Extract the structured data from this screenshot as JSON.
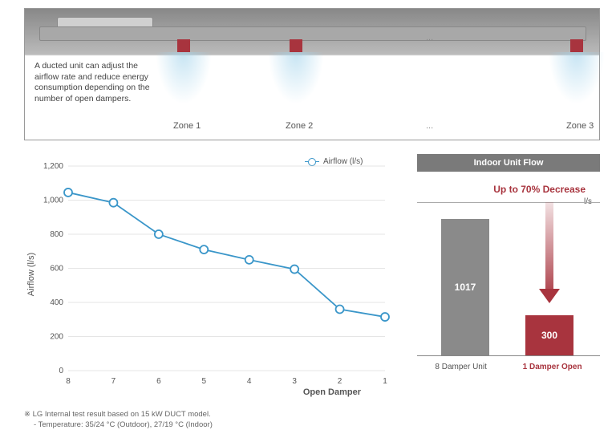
{
  "diagram": {
    "description": "A ducted unit can adjust the airflow rate and reduce energy consumption depending on the number of open dampers.",
    "zones": [
      "Zone 1",
      "Zone 2",
      "...",
      "Zone 3"
    ]
  },
  "chart_data": {
    "type": "line",
    "title": "",
    "xlabel": "Open Damper",
    "ylabel": "Airflow (l/s)",
    "categories": [
      8,
      7,
      6,
      5,
      4,
      3,
      2,
      1
    ],
    "series": [
      {
        "name": "Airflow (l/s)",
        "values": [
          1045,
          985,
          800,
          710,
          650,
          595,
          360,
          315
        ]
      }
    ],
    "ylim": [
      0,
      1200
    ],
    "yticks": [
      0,
      200,
      400,
      600,
      800,
      1000,
      1200
    ]
  },
  "bar_panel": {
    "title": "Indoor Unit Flow",
    "decrease": "Up to 70% Decrease",
    "unit": "l/s",
    "bars": [
      {
        "label": "8 Damper Unit",
        "value": 1017
      },
      {
        "label": "1 Damper Open",
        "value": 300
      }
    ]
  },
  "footnote": {
    "line1": "※ LG Internal test result based on 15 kW DUCT model.",
    "line2": "- Temperature: 35/24 °C (Outdoor), 27/19 °C (Indoor)"
  },
  "legend": "Airflow (l/s)"
}
